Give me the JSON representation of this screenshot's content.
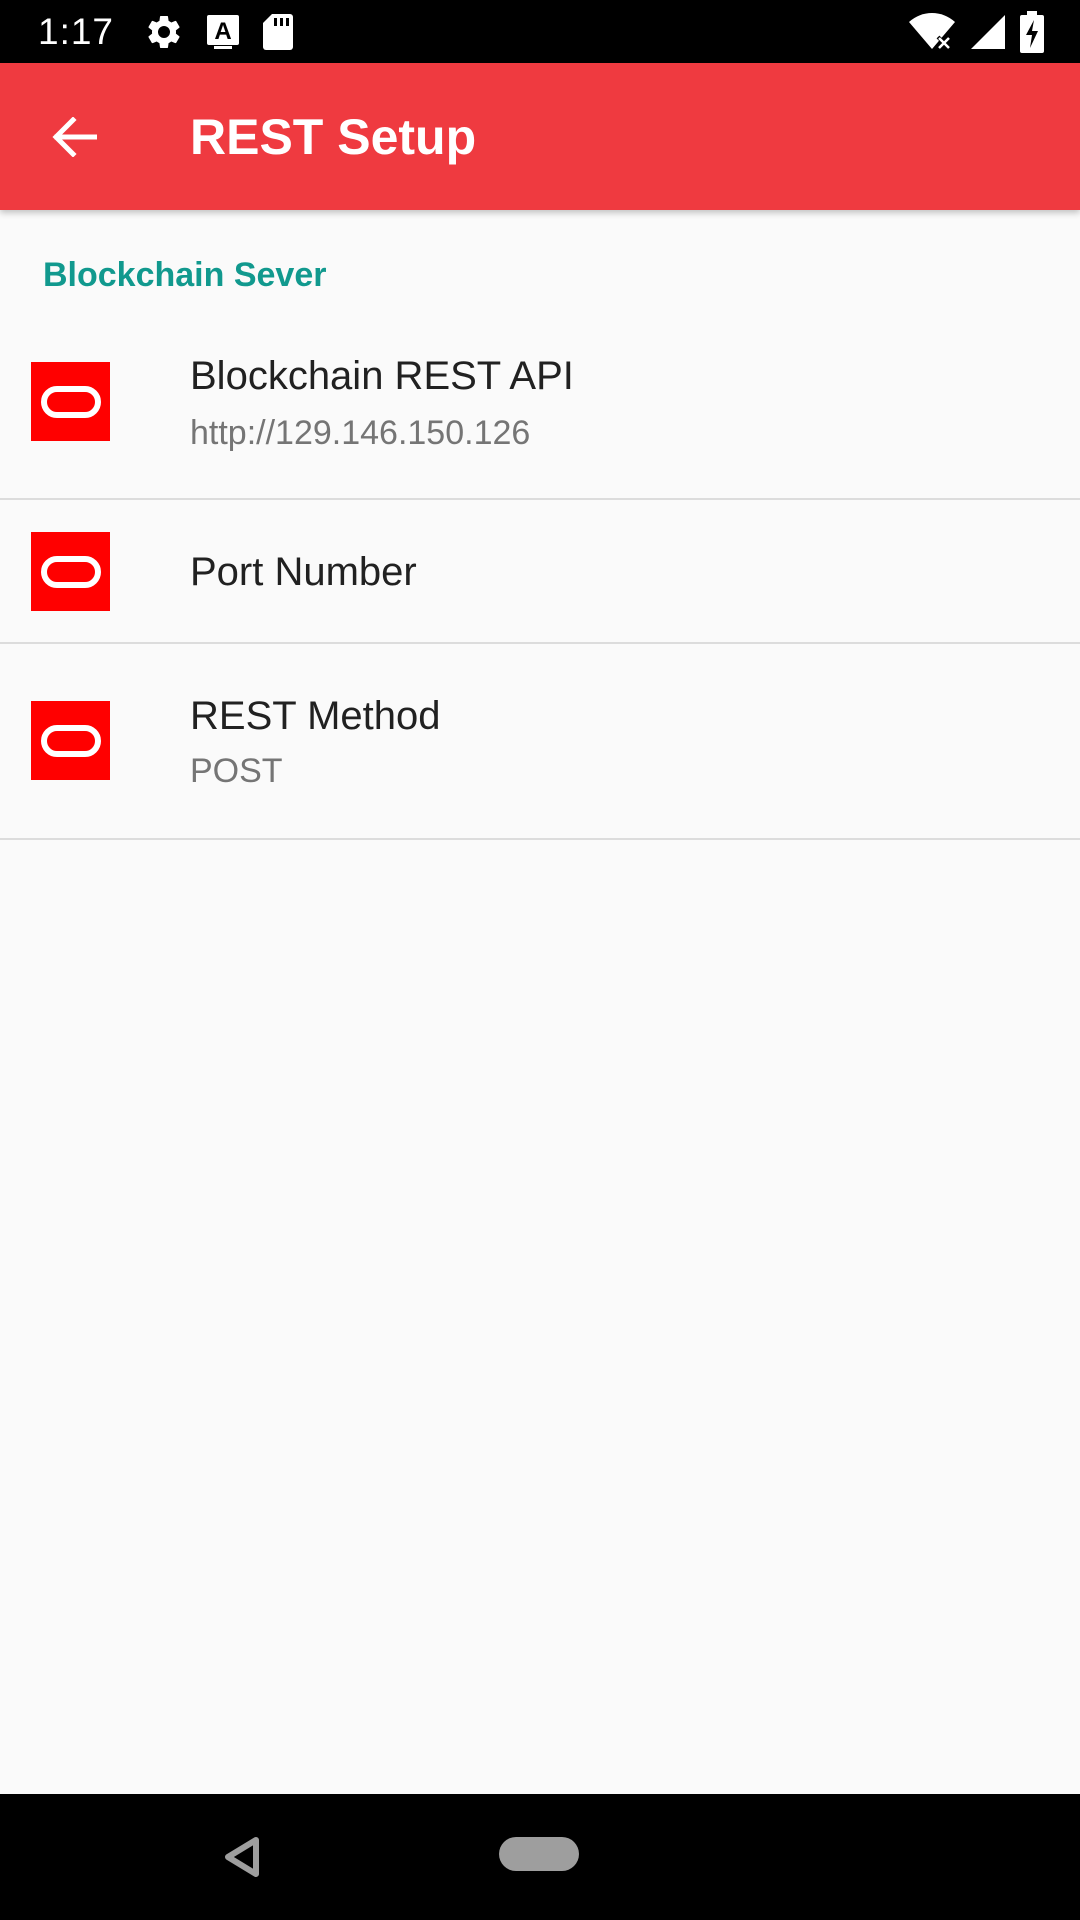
{
  "status_bar": {
    "time": "1:17",
    "left_icons": [
      "gear-icon",
      "a-keyboard-icon",
      "sd-card-icon"
    ],
    "right_icons": [
      "wifi-icon",
      "cell-signal-icon",
      "battery-charging-icon"
    ]
  },
  "app_bar": {
    "title": "REST Setup",
    "color": "#ef3a40"
  },
  "section": {
    "header": "Blockchain Sever",
    "accent_color": "#11998e"
  },
  "preferences": [
    {
      "title": "Blockchain REST API",
      "summary": "http://129.146.150.126",
      "icon": "oracle-logo-icon"
    },
    {
      "title": "Port Number",
      "summary": "",
      "icon": "oracle-logo-icon"
    },
    {
      "title": "REST Method",
      "summary": "POST",
      "icon": "oracle-logo-icon"
    }
  ],
  "nav_bar": {
    "buttons": [
      "back-triangle-icon",
      "home-pill-icon"
    ]
  }
}
